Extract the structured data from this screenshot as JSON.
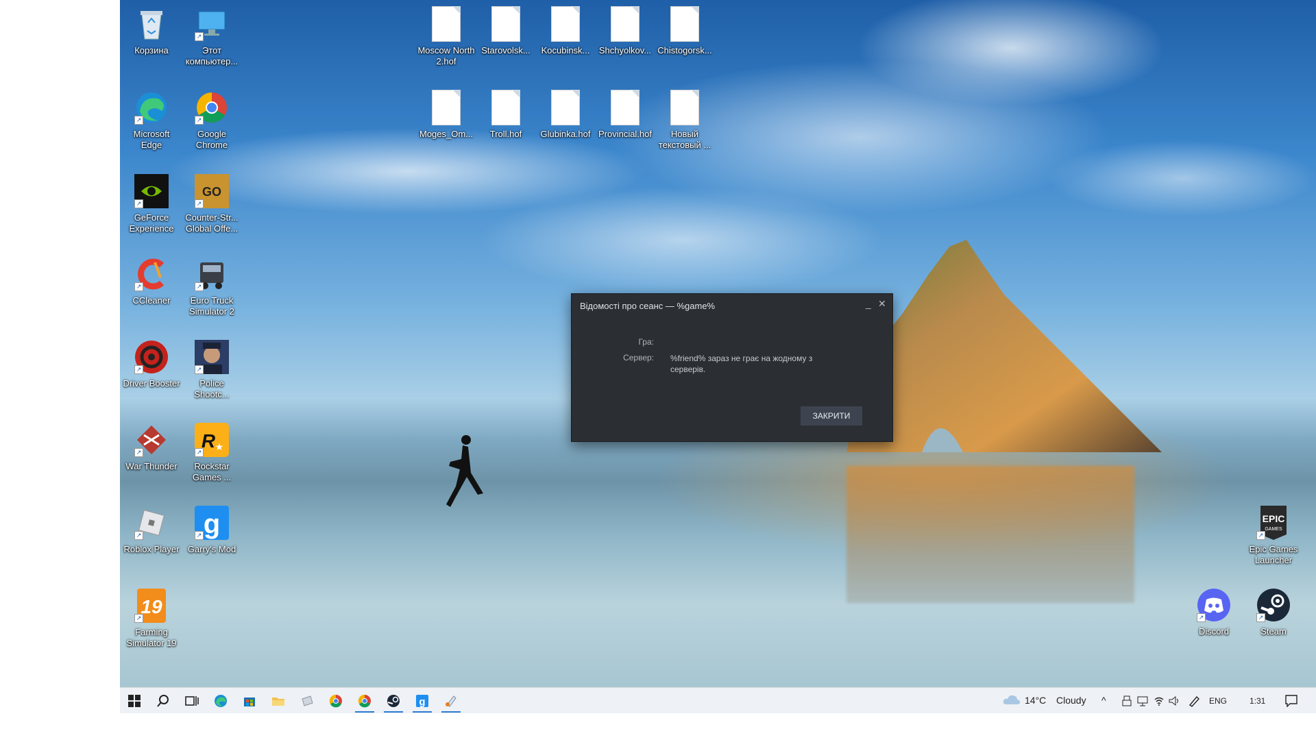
{
  "desktop": {
    "left_icons": [
      {
        "label": "Корзина",
        "icon": "recycle-bin-icon"
      },
      {
        "label": "Этот компьютер...",
        "icon": "this-pc-icon"
      },
      {
        "label": "Microsoft Edge",
        "icon": "edge-icon"
      },
      {
        "label": "Google Chrome",
        "icon": "chrome-icon"
      },
      {
        "label": "GeForce Experience",
        "icon": "geforce-icon"
      },
      {
        "label": "Counter-Str... Global Offe...",
        "icon": "csgo-icon"
      },
      {
        "label": "CCleaner",
        "icon": "ccleaner-icon"
      },
      {
        "label": "Euro Truck Simulator 2",
        "icon": "ets2-icon"
      },
      {
        "label": "Driver Booster",
        "icon": "driver-booster-icon"
      },
      {
        "label": "Police Shootc...",
        "icon": "police-game-icon"
      },
      {
        "label": "War Thunder",
        "icon": "war-thunder-icon"
      },
      {
        "label": "Rockstar Games ...",
        "icon": "rockstar-icon"
      },
      {
        "label": "Roblox Player",
        "icon": "roblox-icon"
      },
      {
        "label": "Garry's Mod",
        "icon": "garrys-mod-icon"
      },
      {
        "label": "Farming Simulator 19",
        "icon": "farming-sim-icon"
      }
    ],
    "files": [
      {
        "label": "Moscow North 2.hof"
      },
      {
        "label": "Starovolsk..."
      },
      {
        "label": "Kocubinsk..."
      },
      {
        "label": "Shchyolkov..."
      },
      {
        "label": "Chistogorsk..."
      },
      {
        "label": "Moges_Om..."
      },
      {
        "label": "Troll.hof"
      },
      {
        "label": "Glubinka.hof"
      },
      {
        "label": "Provincial.hof"
      },
      {
        "label": "Новый текстовый ..."
      }
    ],
    "right_icons": [
      {
        "label": "Epic Games Launcher",
        "icon": "epic-games-icon"
      },
      {
        "label": "Discord",
        "icon": "discord-icon"
      },
      {
        "label": "Steam",
        "icon": "steam-icon"
      }
    ]
  },
  "dialog": {
    "title": "Відомості про сеанс — %game%",
    "minimize": "_",
    "close": "✕",
    "game_label": "Гра:",
    "game_value": "",
    "server_label": "Сервер:",
    "server_value": "%friend% зараз не грає на жодному з серверів.",
    "close_button": "ЗАКРИТИ"
  },
  "taskbar": {
    "weather_temp": "14°C",
    "weather_text": "Cloudy",
    "language": "ENG",
    "time": "1:31",
    "apps": [
      "start-icon",
      "search-icon",
      "task-view-icon",
      "edge-icon",
      "store-icon",
      "file-explorer-icon",
      "app-icon",
      "chrome-icon",
      "chrome-profile-icon",
      "steam-icon",
      "garrys-mod-icon",
      "paint-icon"
    ]
  }
}
